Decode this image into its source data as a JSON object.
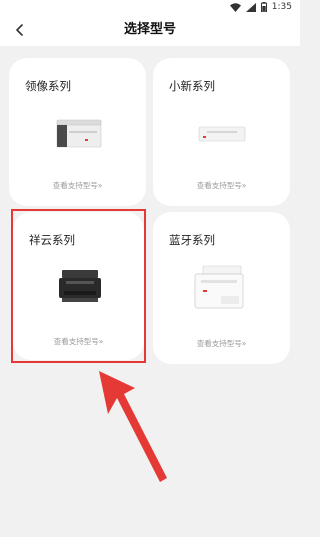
{
  "status": {
    "time": "1:35"
  },
  "header": {
    "title": "选择型号"
  },
  "cards": [
    {
      "title": "领像系列",
      "link": "查看支持型号»"
    },
    {
      "title": "小新系列",
      "link": "查看支持型号»"
    },
    {
      "title": "祥云系列",
      "link": "查看支持型号»"
    },
    {
      "title": "蓝牙系列",
      "link": "查看支持型号»"
    }
  ],
  "colors": {
    "highlight": "#e53935",
    "arrow": "#e53935",
    "background": "#f1f1f1"
  }
}
